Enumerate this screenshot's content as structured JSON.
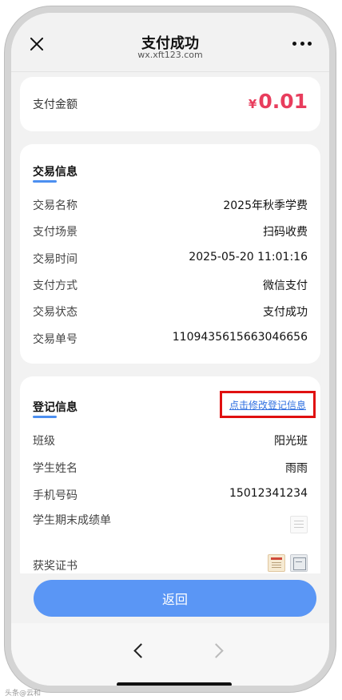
{
  "header": {
    "title": "支付成功",
    "subtitle": "wx.xft123.com",
    "close_icon": "close-icon",
    "more_icon": "more-dots-icon"
  },
  "amount": {
    "label": "支付金额",
    "currency": "¥",
    "value": "0.01",
    "color": "#e83d5d"
  },
  "trade": {
    "title": "交易信息",
    "rows": [
      {
        "key": "交易名称",
        "value": "2025年秋季学费"
      },
      {
        "key": "支付场景",
        "value": "扫码收费"
      },
      {
        "key": "交易时间",
        "value": "2025-05-20 11:01:16"
      },
      {
        "key": "支付方式",
        "value": "微信支付"
      },
      {
        "key": "交易状态",
        "value": "支付成功"
      },
      {
        "key": "交易单号",
        "value": "1109435615663046656"
      }
    ]
  },
  "registration": {
    "title": "登记信息",
    "edit_link": "点击修改登记信息",
    "rows": [
      {
        "key": "班级",
        "value": "阳光班"
      },
      {
        "key": "学生姓名",
        "value": "雨雨"
      },
      {
        "key": "手机号码",
        "value": "15012341234"
      },
      {
        "key": "学生期末成绩单",
        "value": ""
      },
      {
        "key": "获奖证书",
        "value": ""
      }
    ]
  },
  "footer": {
    "return_label": "返回",
    "accent_color": "#5a96f5"
  },
  "toolbar": {
    "back_icon": "chevron-left-icon",
    "forward_icon": "chevron-right-icon"
  },
  "watermark": "头条@云和"
}
